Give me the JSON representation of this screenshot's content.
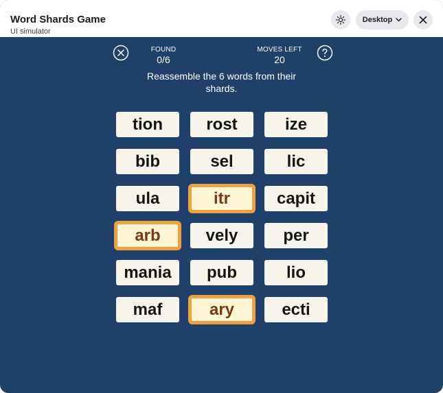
{
  "window": {
    "title": "Word Shards Game",
    "subtitle": "UI simulator",
    "device_select": "Desktop"
  },
  "game": {
    "found_label": "FOUND",
    "found_value": "0/6",
    "moves_label": "MOVES LEFT",
    "moves_value": "20",
    "instructions": "Reassemble the 6 words from their shards."
  },
  "tiles": [
    {
      "text": "tion",
      "selected": false
    },
    {
      "text": "rost",
      "selected": false
    },
    {
      "text": "ize",
      "selected": false
    },
    {
      "text": "bib",
      "selected": false
    },
    {
      "text": "sel",
      "selected": false
    },
    {
      "text": "lic",
      "selected": false
    },
    {
      "text": "ula",
      "selected": false
    },
    {
      "text": "itr",
      "selected": true
    },
    {
      "text": "capit",
      "selected": false
    },
    {
      "text": "arb",
      "selected": true
    },
    {
      "text": "vely",
      "selected": false
    },
    {
      "text": "per",
      "selected": false
    },
    {
      "text": "mania",
      "selected": false
    },
    {
      "text": "pub",
      "selected": false
    },
    {
      "text": "lio",
      "selected": false
    },
    {
      "text": "maf",
      "selected": false
    },
    {
      "text": "ary",
      "selected": true
    },
    {
      "text": "ecti",
      "selected": false
    }
  ],
  "colors": {
    "background": "#1f4068",
    "tile": "#f7f4ec",
    "selected_border": "#f2a03d",
    "selected_text": "#7a3a14"
  },
  "icons": {
    "theme": "sun-icon",
    "device_chevron": "chevron-down-icon",
    "close_window": "close-icon",
    "exit_game": "circle-x-icon",
    "help": "question-circle-icon"
  }
}
